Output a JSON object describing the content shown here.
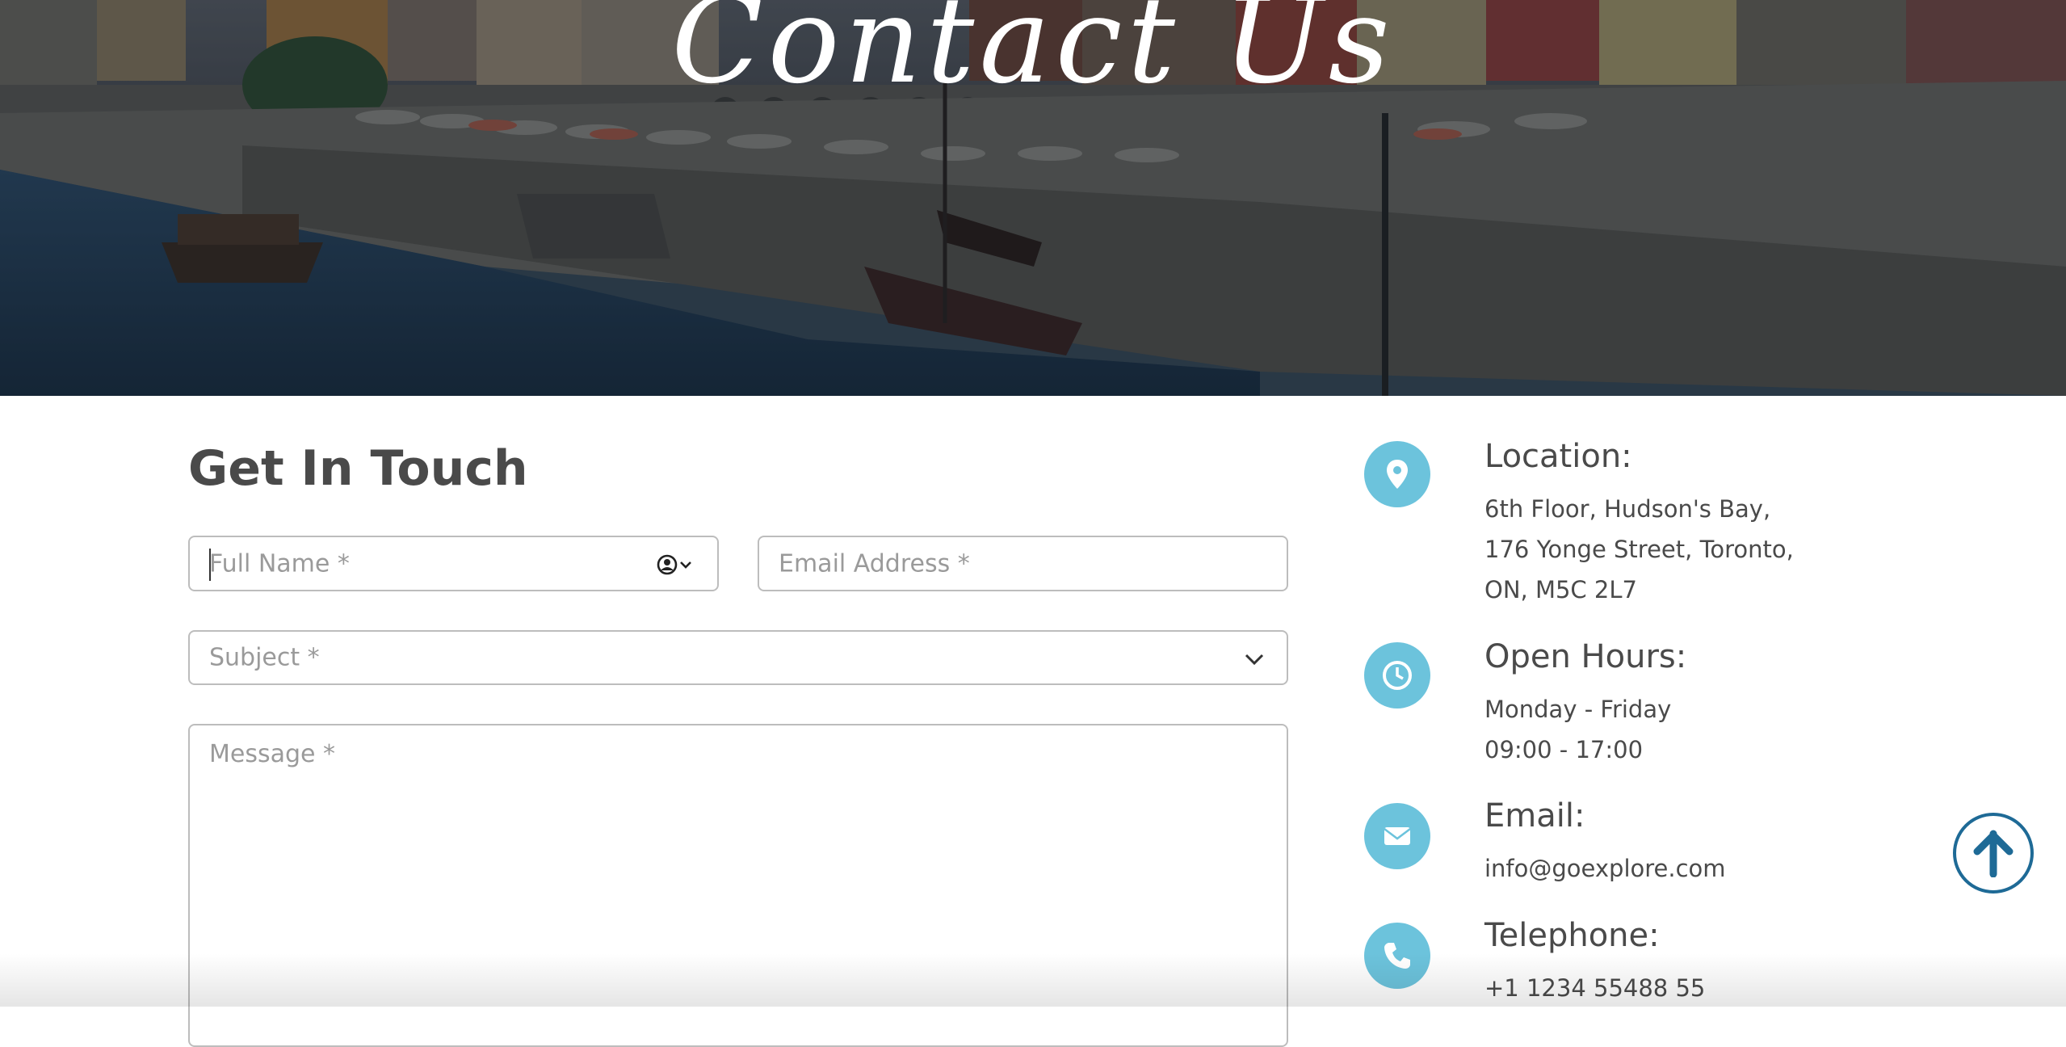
{
  "hero": {
    "title": "Contact Us",
    "image_description_icon": "harbor-photo"
  },
  "form": {
    "heading": "Get In Touch",
    "full_name_placeholder": "Full Name *",
    "email_placeholder": "Email Address *",
    "subject_placeholder": "Subject *",
    "message_placeholder": "Message *",
    "icons": {
      "autofill": "contact-card-icon",
      "subject_dropdown": "chevron-down-icon"
    }
  },
  "info": {
    "location": {
      "label": "Location:",
      "lines": [
        "6th Floor, Hudson's Bay,",
        "176 Yonge Street, Toronto,",
        "ON, M5C 2L7"
      ],
      "icon": "map-pin-icon"
    },
    "hours": {
      "label": "Open Hours:",
      "lines": [
        "Monday - Friday",
        "09:00 - 17:00"
      ],
      "icon": "clock-icon"
    },
    "email": {
      "label": "Email:",
      "lines": [
        "info@goexplore.com"
      ],
      "icon": "envelope-icon"
    },
    "telephone": {
      "label": "Telephone:",
      "lines": [
        "+1 1234 55488 55"
      ],
      "icon": "phone-icon"
    }
  },
  "back_to_top": {
    "icon": "arrow-up-icon"
  },
  "colors": {
    "accent": "#6cc3dc",
    "back_to_top": "#1e6a96",
    "text": "#4a4a4a",
    "placeholder": "#9a9a9a"
  }
}
